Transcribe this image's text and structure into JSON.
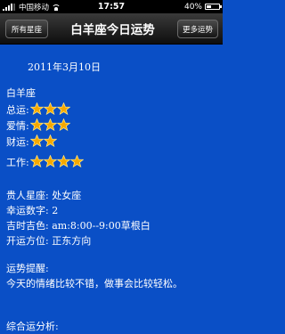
{
  "status_bar": {
    "carrier": "中国移动",
    "time": "17:57",
    "battery_text": "40%",
    "battery_level": 0.4,
    "signal_bars": 4
  },
  "nav": {
    "left_button": "所有星座",
    "title": "白羊座今日运势",
    "right_button": "更多运势"
  },
  "content": {
    "date": "2011年3月10日",
    "sign": "白羊座",
    "ratings": [
      {
        "label": "总运:",
        "stars": 3
      },
      {
        "label": "爱情:",
        "stars": 3
      },
      {
        "label": "财运:",
        "stars": 2
      },
      {
        "label": "工作:",
        "stars": 4
      }
    ],
    "details": [
      "贵人星座: 处女座",
      "幸运数字: 2",
      "吉时吉色: am:8:00--9:00草根白",
      "开运方位: 正东方向"
    ],
    "tip_title": "运势提醒:",
    "tip_text": "今天的情绪比较不错，做事会比较轻松。",
    "analysis_title": "综合运分析:"
  },
  "colors": {
    "background": "#0a4fc6",
    "star_fill": "#f6a800",
    "star_stroke": "#ffe27a"
  }
}
